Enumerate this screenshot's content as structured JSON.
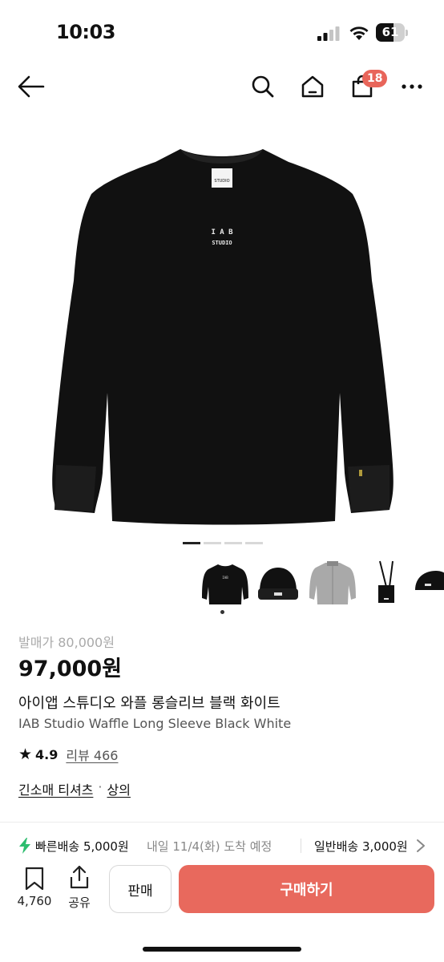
{
  "status_bar": {
    "time": "10:03",
    "battery_level": "61",
    "icons": [
      "signal-icon",
      "wifi-icon",
      "battery-icon"
    ]
  },
  "nav": {
    "icons": [
      "back-arrow-icon",
      "search-icon",
      "home-icon",
      "shopping-bag-icon",
      "more-icon"
    ],
    "cart_count": "18",
    "badge_color": "#e8655a"
  },
  "hero": {
    "chest_logo_top": "I A B",
    "chest_logo_bottom": "STUDIO",
    "neck_label": "STUDIO",
    "image_count": 4,
    "active_index": 0
  },
  "thumbnails": [
    "black-long-sleeve",
    "black-beanie",
    "grey-jacket",
    "black-crossbody-bag",
    "black-cap"
  ],
  "product": {
    "list_price": "발매가 80,000원",
    "price": "97,000원",
    "name_ko": "아이앱 스튜디오 와플 롱슬리브 블랙 화이트",
    "name_en": "IAB Studio Waffle Long Sleeve Black White",
    "rating": "4.9",
    "review_label": "리뷰 466",
    "category_main": "긴소매 티셔츠",
    "category_sep": "·",
    "category_sub": "상의"
  },
  "shipping": {
    "fast_label": "빠른배송 5,000원",
    "fast_eta": "내일 11/4(화) 도착 예정",
    "normal_label": "일반배송 3,000원",
    "bolt_color": "#2dbd6e"
  },
  "bottom_bar": {
    "bookmark_count": "4,760",
    "share_label": "공유",
    "sell_label": "판매",
    "buy_label": "구매하기",
    "buy_color": "#e8695d"
  }
}
